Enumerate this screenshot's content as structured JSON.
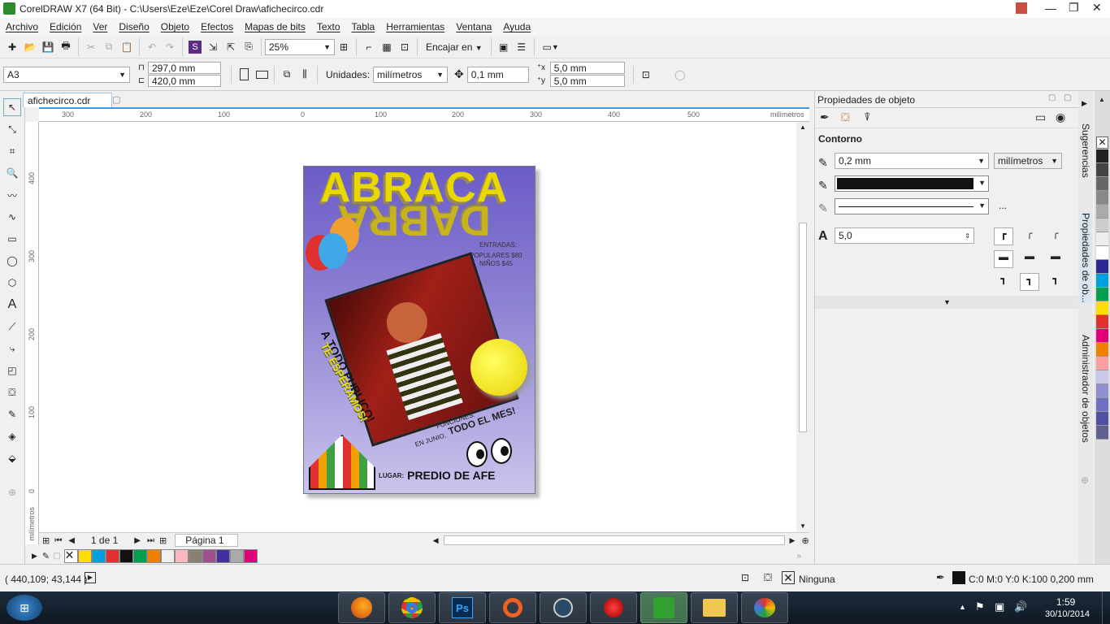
{
  "title": "CorelDRAW X7 (64 Bit) - C:\\Users\\Eze\\Eze\\Corel Draw\\afichecirco.cdr",
  "menu": [
    "Archivo",
    "Edición",
    "Ver",
    "Diseño",
    "Objeto",
    "Efectos",
    "Mapas de bits",
    "Texto",
    "Tabla",
    "Herramientas",
    "Ventana",
    "Ayuda"
  ],
  "toolbar": {
    "zoom": "25%",
    "snap": "Encajar en"
  },
  "property_bar": {
    "page_size": "A3",
    "width": "297,0 mm",
    "height": "420,0 mm",
    "units_label": "Unidades:",
    "units": "milímetros",
    "nudge": "0,1 mm",
    "dup_x": "5,0 mm",
    "dup_y": "5,0 mm"
  },
  "doc_tab": "afichecirco.cdr",
  "ruler": {
    "h_ticks": [
      "300",
      "200",
      "100",
      "0",
      "100",
      "200",
      "300",
      "400",
      "500"
    ],
    "h_unit": "milímetros",
    "v_ticks": [
      "400",
      "300",
      "200",
      "100",
      "0"
    ],
    "v_unit": "milímetros"
  },
  "poster": {
    "abraca": "ABRACA",
    "dabra": "DABRA",
    "entradas": "ENTRADAS:",
    "prices": "POPULARES $80",
    "ninos": "NIÑOS $45",
    "publico": "A TODO PUBLICO!",
    "esperamos": "TE ESPERAMOS!",
    "funciones": "FUNCIONES:",
    "junio": "EN JUNIO,",
    "todo_mes": "TODO EL MES!",
    "lugar_label": "LUGAR:",
    "lugar": "PREDIO DE AFE"
  },
  "page_nav": {
    "counter": "1 de 1",
    "page_tab": "Página 1"
  },
  "palette_colors": [
    "#ffdd00",
    "#00a0e0",
    "#e03030",
    "#111111",
    "#00a050",
    "#f08000",
    "#f0f0f0",
    "#f8b8c0",
    "#888070",
    "#a05090",
    "#4030a0",
    "#aaaaaa",
    "#e0007a"
  ],
  "status": {
    "coords": "( 440,109; 43,144 )",
    "fill": "Ninguna",
    "outline": "C:0 M:0 Y:0 K:100  0,200 mm"
  },
  "docker": {
    "title": "Propiedades de objeto",
    "section": "Contorno",
    "width": "0,2 mm",
    "units": "milímetros",
    "miter": "5,0",
    "more": "..."
  },
  "dock_tabs": [
    "Sugerencias",
    "Propiedades de ob...",
    "Administrador de objetos"
  ],
  "color_strip": [
    "#222222",
    "#444444",
    "#666666",
    "#888888",
    "#aaaaaa",
    "#cccccc",
    "#eeeeee",
    "#ffffff",
    "#2a2a90",
    "#00a0e0",
    "#00a050",
    "#ffdd00",
    "#e03030",
    "#e0007a",
    "#f08000",
    "#f8a0a0",
    "#c8c8e8",
    "#9090d0",
    "#7070c0",
    "#5050a0",
    "#606090"
  ],
  "clock": {
    "time": "1:59",
    "date": "30/10/2014"
  }
}
